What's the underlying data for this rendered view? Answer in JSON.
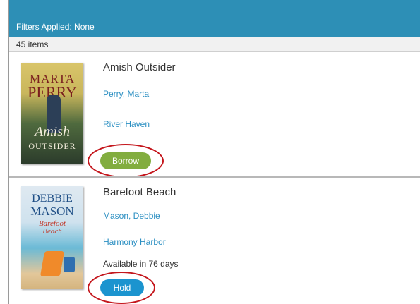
{
  "filter_bar": {
    "text": "Filters Applied: None",
    "color": "#2d8fb6"
  },
  "result_count": "45 items",
  "books": [
    {
      "title": "Amish Outsider",
      "author": "Perry, Marta",
      "series": "River Haven",
      "status": "",
      "action_label": "Borrow",
      "action_color": "#82ad3f",
      "cover": {
        "author_line1": "MARTA",
        "author_line2": "PERRY",
        "title_line1": "Amish",
        "title_line2": "OUTSIDER"
      }
    },
    {
      "title": "Barefoot Beach",
      "author": "Mason, Debbie",
      "series": "Harmony Harbor",
      "status": "Available in 76 days",
      "action_label": "Hold",
      "action_color": "#1b94cf",
      "cover": {
        "author_line1": "DEBBIE",
        "author_line2": "MASON",
        "title_line1": "Barefoot",
        "title_line2": "Beach"
      }
    }
  ],
  "annotation_color": "#c4161c"
}
